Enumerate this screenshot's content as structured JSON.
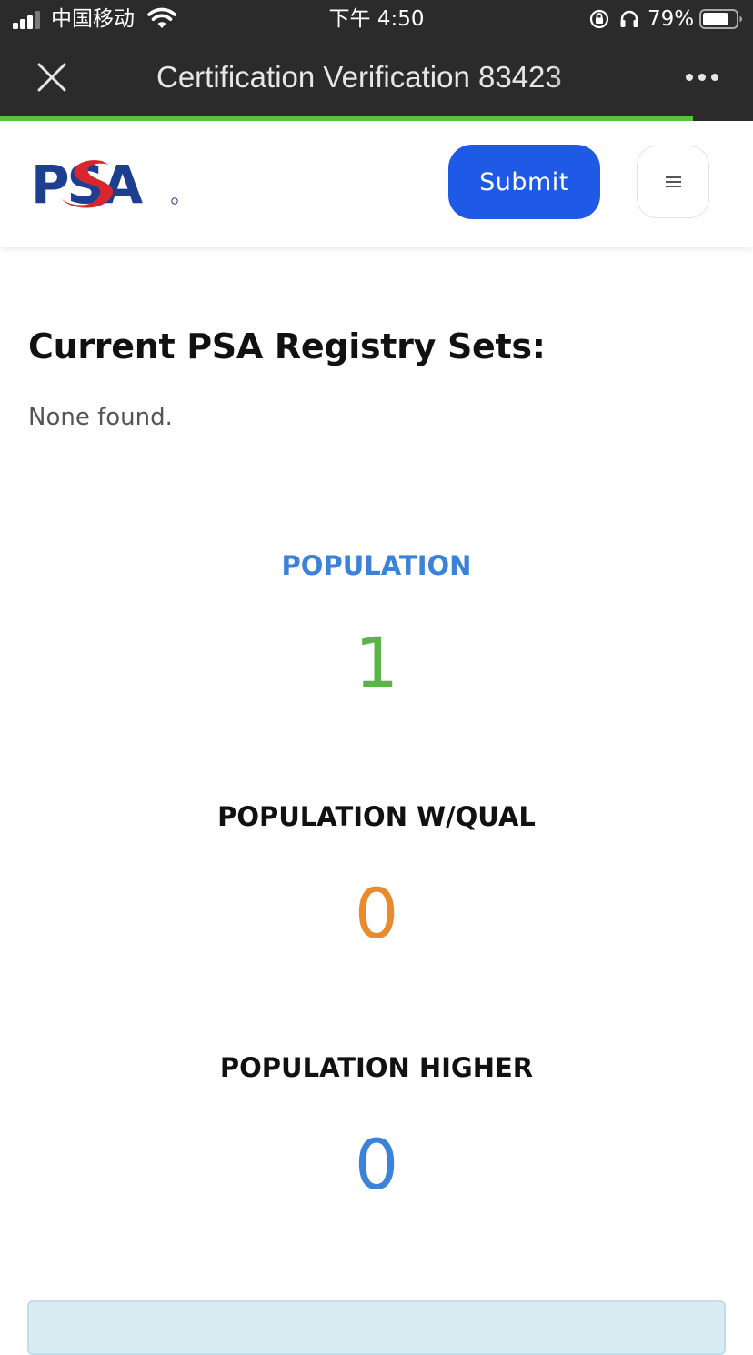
{
  "status_bar": {
    "carrier": "中国移动",
    "time": "下午 4:50",
    "battery": "79%",
    "battery_level": 0.79
  },
  "browser": {
    "title": "Certification Verification 83423",
    "load_progress": 0.92
  },
  "header": {
    "logo_text": "PSA",
    "submit_label": "Submit",
    "menu_label": "≡"
  },
  "registry": {
    "heading": "Current PSA Registry Sets:",
    "empty_text": "None found."
  },
  "population": [
    {
      "label": "POPULATION",
      "value": "1",
      "color": "#5ab545",
      "label_color": "#3c82d9"
    },
    {
      "label": "POPULATION W/QUAL",
      "value": "0",
      "color": "#e98a2d",
      "label_color": "#111111"
    },
    {
      "label": "POPULATION HIGHER",
      "value": "0",
      "color": "#3c82d9",
      "label_color": "#111111"
    }
  ],
  "colors": {
    "brand_blue": "#1f5ae6",
    "logo_navy": "#1d3f8f",
    "logo_red": "#d8262e",
    "loading_green": "#5ac13f"
  },
  "icons": [
    "signal-icon",
    "wifi-icon",
    "orientation-lock-icon",
    "headphones-icon",
    "battery-icon",
    "close-icon",
    "more-icon",
    "menu-icon"
  ]
}
